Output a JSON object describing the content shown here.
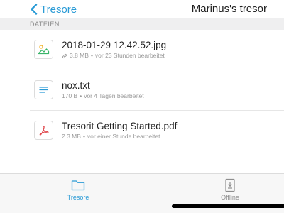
{
  "navbar": {
    "back_label": "Tresore",
    "title": "Marinus's tresor"
  },
  "section": {
    "label": "DATEIEN"
  },
  "files": [
    {
      "name": "2018-01-29 12.42.52.jpg",
      "size": "3.8 MB",
      "modified": "vor 23 Stunden bearbeitet",
      "icon": "image-file-icon",
      "shared_link": true
    },
    {
      "name": "nox.txt",
      "size": "170 B",
      "modified": "vor 4 Tagen bearbeitet",
      "icon": "text-file-icon",
      "shared_link": false
    },
    {
      "name": "Tresorit Getting Started.pdf",
      "size": "2.3 MB",
      "modified": "vor einer Stunde bearbeitet",
      "icon": "pdf-file-icon",
      "shared_link": false
    }
  ],
  "meta_separator": "•",
  "tabbar": {
    "tabs": [
      {
        "label": "Tresore",
        "icon": "folder-icon",
        "active": true
      },
      {
        "label": "Offline",
        "icon": "offline-icon",
        "active": false
      }
    ]
  },
  "colors": {
    "accent": "#2a9bd6",
    "section_bg": "#efeff0",
    "muted_text": "#9a9a9a",
    "pdf_red": "#e0474c",
    "image_green": "#3bb56a",
    "image_yellow": "#f2b632"
  }
}
